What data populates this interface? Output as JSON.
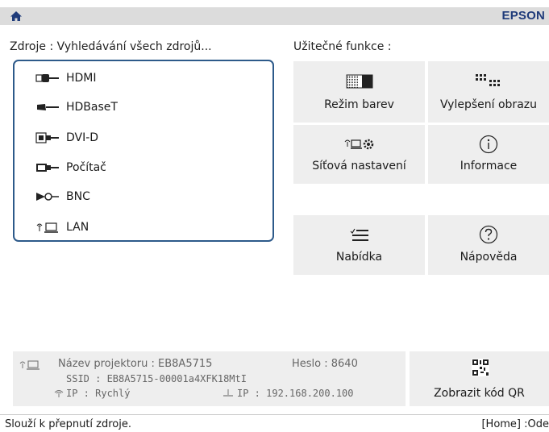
{
  "header": {
    "brand": "EPSON"
  },
  "sources": {
    "title": "Zdroje : Vyhledávání všech zdrojů...",
    "items": [
      {
        "label": "HDMI",
        "icon": "hdmi-port-icon"
      },
      {
        "label": "HDBaseT",
        "icon": "hdbaset-port-icon"
      },
      {
        "label": "DVI-D",
        "icon": "dvi-port-icon"
      },
      {
        "label": "Počítač",
        "icon": "computer-port-icon"
      },
      {
        "label": "BNC",
        "icon": "bnc-port-icon"
      },
      {
        "label": "LAN",
        "icon": "lan-icon"
      }
    ]
  },
  "functions": {
    "title": "Užitečné funkce :",
    "tiles": [
      {
        "label": "Režim barev",
        "icon": "color-mode-icon"
      },
      {
        "label": "Vylepšení obrazu",
        "icon": "image-enhancement-icon"
      },
      {
        "label": "Síťová nastavení",
        "icon": "network-settings-icon"
      },
      {
        "label": "Informace",
        "icon": "info-icon"
      },
      {
        "label": "Nabídka",
        "icon": "menu-list-icon"
      },
      {
        "label": "Nápověda",
        "icon": "help-icon"
      }
    ]
  },
  "info": {
    "projector_name_label": "Název projektoru : EB8A5715",
    "password_label": "Heslo : 8640",
    "ssid_line": "SSID : EB8A5715-00001a4XFK18MtI",
    "wireless_ip_line": "IP : Rychlý",
    "wired_ip_line": "IP : 192.168.200.100"
  },
  "qr": {
    "label": "Zobrazit kód QR",
    "icon": "qr-code-icon"
  },
  "status": {
    "left": "Slouží k přepnutí zdroje.",
    "right": "[Home] :Ode"
  }
}
